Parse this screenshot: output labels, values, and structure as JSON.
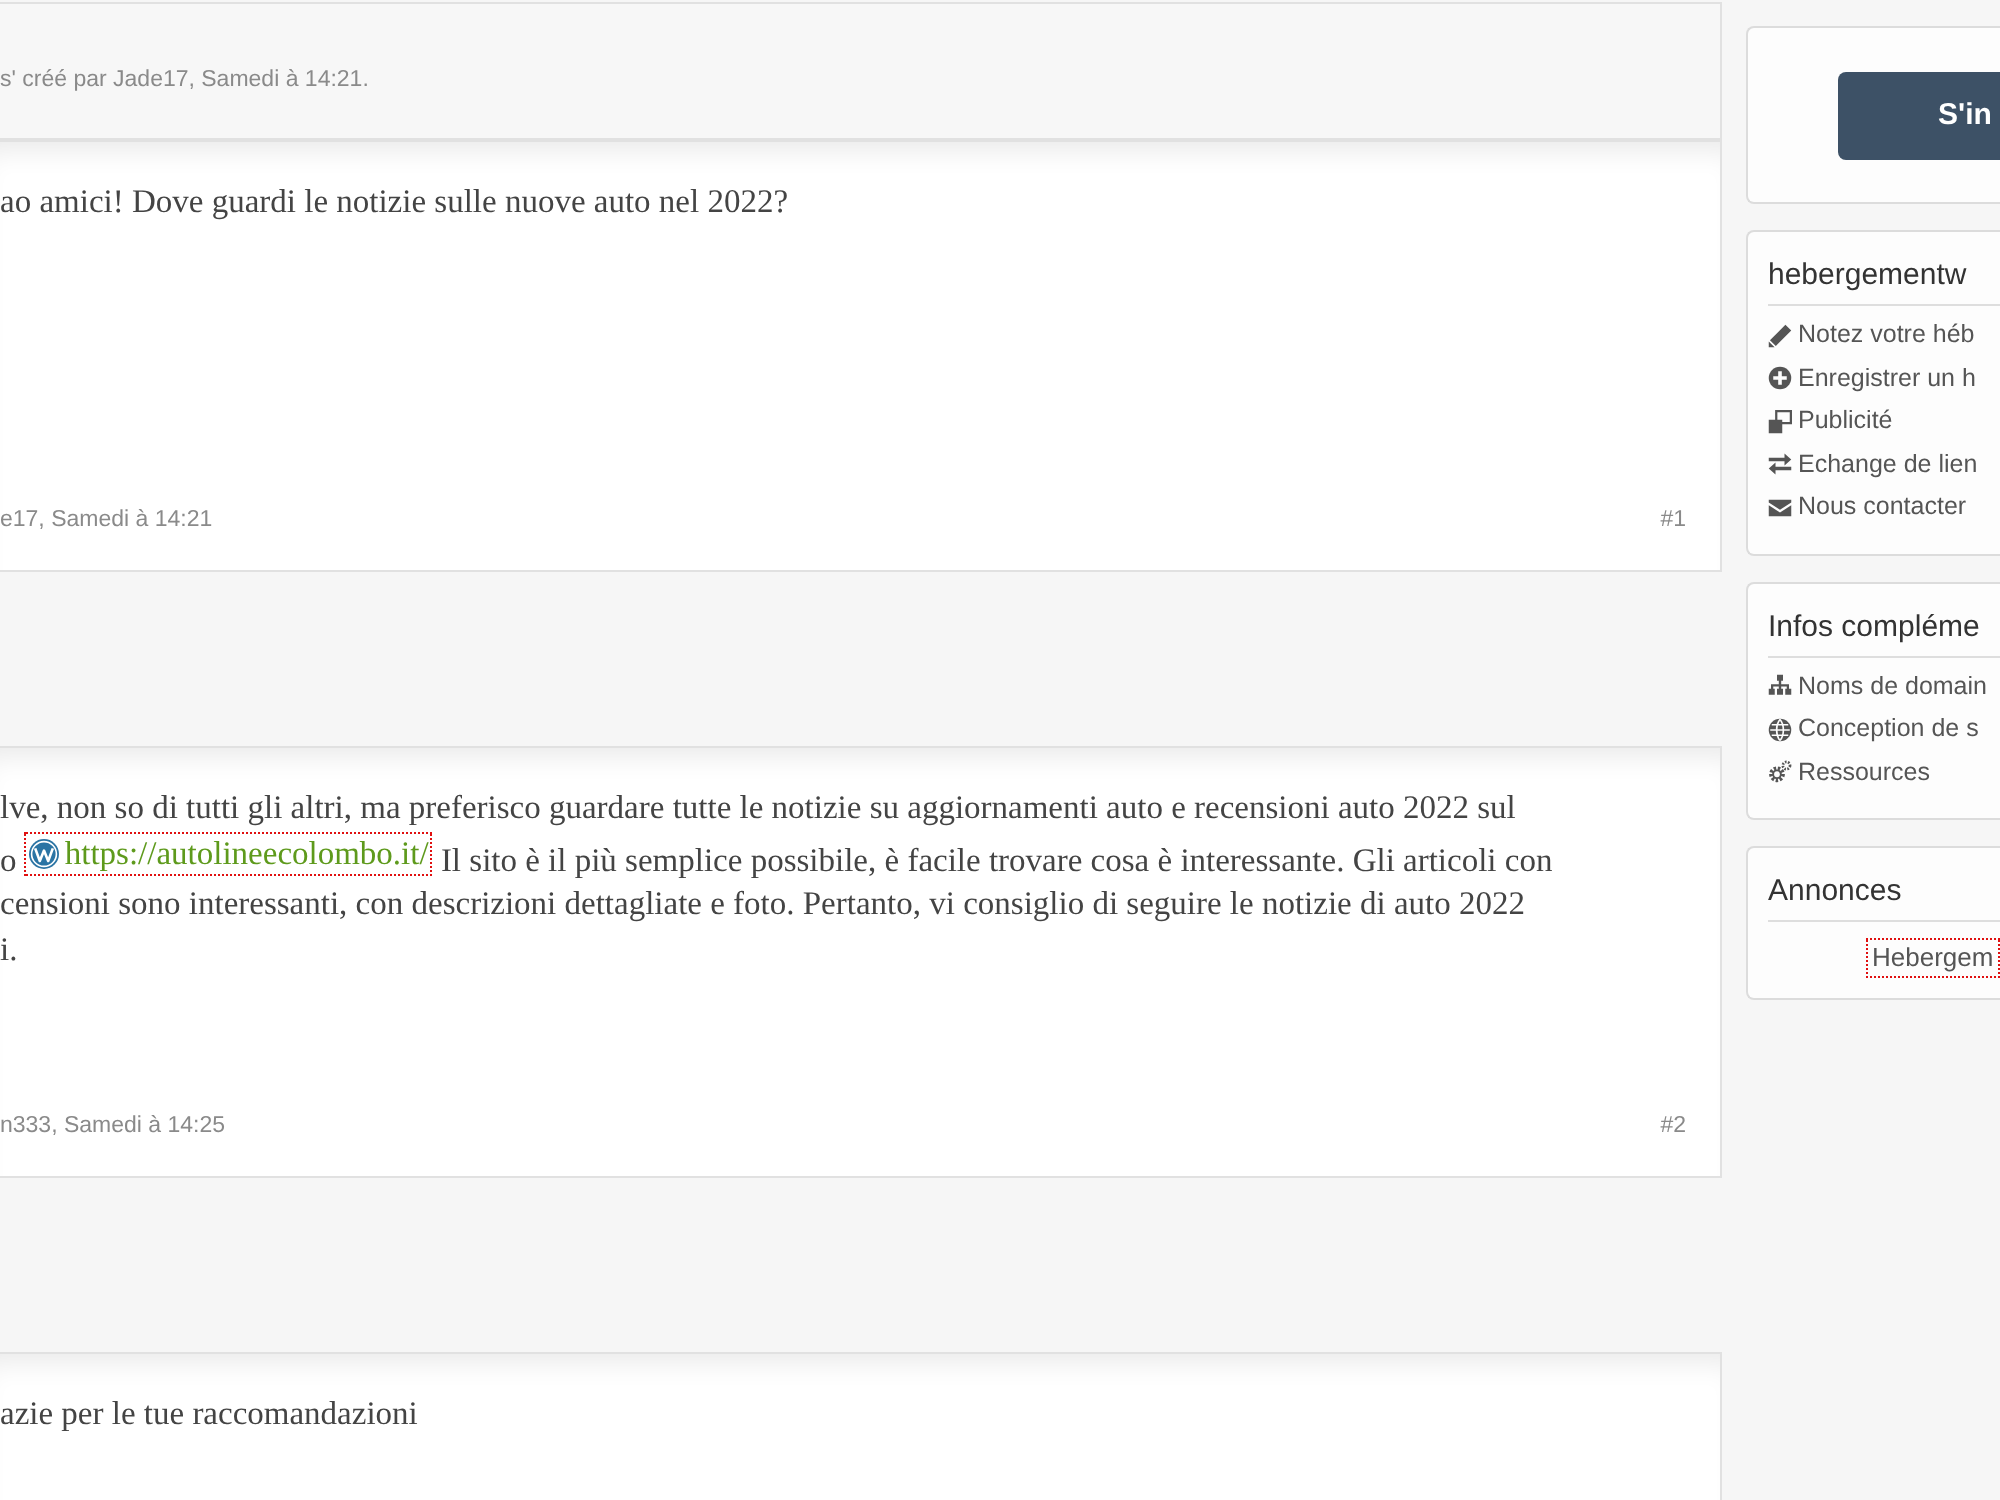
{
  "thread_header": {
    "meta": "s' créé par Jade17, Samedi à 14:21."
  },
  "posts": [
    {
      "body": [
        {
          "kind": "text",
          "text": "ao amici! Dove guardi le notizie sulle nuove auto nel 2022?"
        }
      ],
      "meta": "e17, Samedi à 14:21",
      "number": "#1"
    },
    {
      "body": [
        {
          "kind": "text",
          "text": "lve, non so di tutti gli altri, ma preferisco guardare tutte le notizie su aggiornamenti auto e recensioni auto 2022 sul\no "
        },
        {
          "kind": "link",
          "text": "https://autolineecolombo.it/",
          "highlighted": true
        },
        {
          "kind": "text",
          "text": " Il sito è il più semplice possibile, è facile trovare cosa è interessante. Gli articoli con\ncensioni sono interessanti, con descrizioni dettagliate e foto. Pertanto, vi consiglio di seguire le notizie di auto 2022\ni."
        }
      ],
      "meta": "n333, Samedi à 14:25",
      "number": "#2"
    },
    {
      "body": [
        {
          "kind": "text",
          "text": "azie per le tue raccomandazioni"
        }
      ]
    }
  ],
  "sidebar": {
    "login_button": {
      "label": "S'in"
    },
    "blocks": [
      {
        "kind": "links",
        "title": "hebergementw",
        "items": [
          "Notez votre héb",
          "Enregistrer un h",
          "Publicité",
          "Echange de lien",
          "Nous contacter"
        ]
      },
      {
        "kind": "links",
        "title": "Infos compléme",
        "items": [
          "Noms de domain",
          "Conception de s",
          "Ressources"
        ]
      },
      {
        "kind": "ads",
        "title": "Annonces",
        "link": {
          "label": "Hebergem",
          "highlighted": true
        }
      }
    ]
  }
}
